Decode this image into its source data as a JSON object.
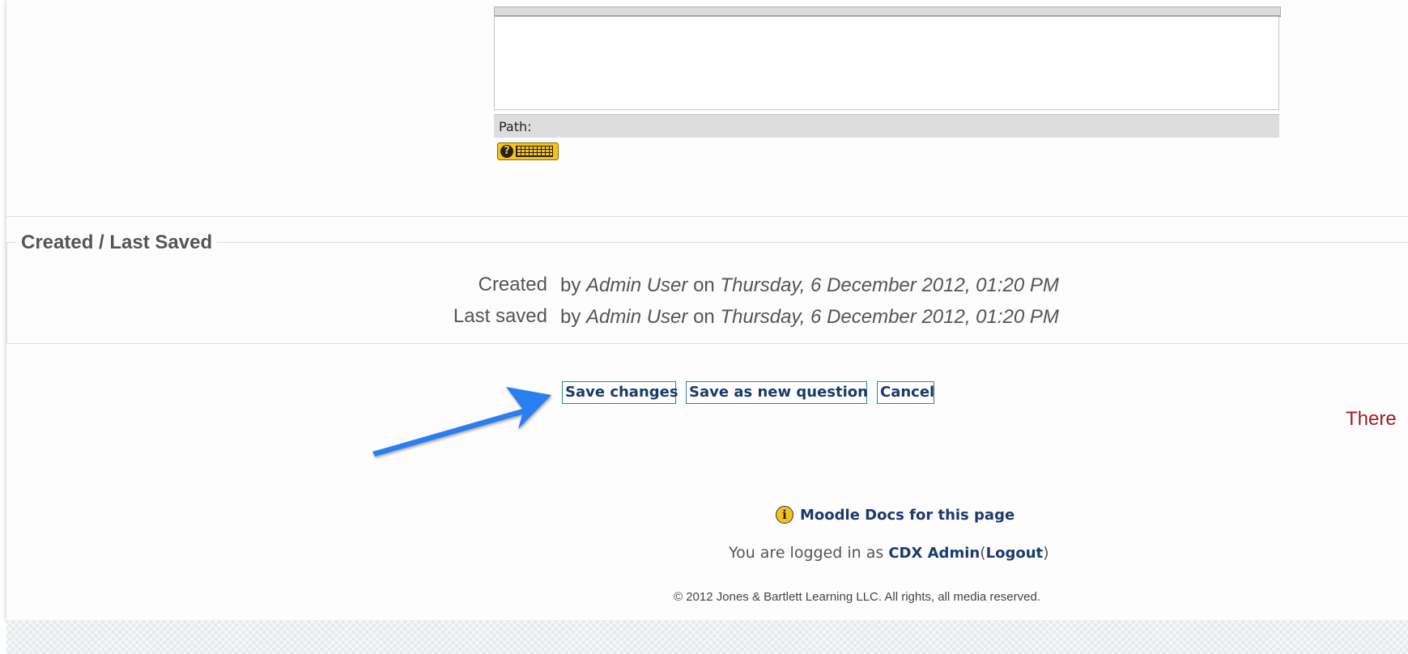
{
  "editor": {
    "path_label": "Path:",
    "help_icon": "help-keyboard-icon"
  },
  "created_section": {
    "legend": "Created / Last Saved",
    "rows": [
      {
        "label": "Created",
        "by": "by",
        "user": "Admin User",
        "on": "on",
        "date": "Thursday, 6 December 2012, 01:20 PM"
      },
      {
        "label": "Last saved",
        "by": "by",
        "user": "Admin User",
        "on": "on",
        "date": "Thursday, 6 December 2012, 01:20 PM"
      }
    ]
  },
  "actions": {
    "save_changes": "Save changes",
    "save_as_new": "Save as new question",
    "cancel": "Cancel"
  },
  "side_text": "There",
  "annotation": {
    "arrow_color": "#2b7ff0"
  },
  "footer": {
    "docs_icon": "info-icon",
    "docs_link": "Moodle Docs for this page",
    "logged_in_prefix": "You are logged in as",
    "user_link": "CDX Admin",
    "open_paren": "(",
    "logout_link": "Logout",
    "close_paren": ")",
    "copyright": "© 2012 Jones & Bartlett Learning LLC. All rights, all media reserved."
  },
  "colors": {
    "link": "#1b3a6b",
    "button_border": "#2a8a98",
    "warning_text": "#a01c28",
    "help_button": "#f8c21e"
  }
}
